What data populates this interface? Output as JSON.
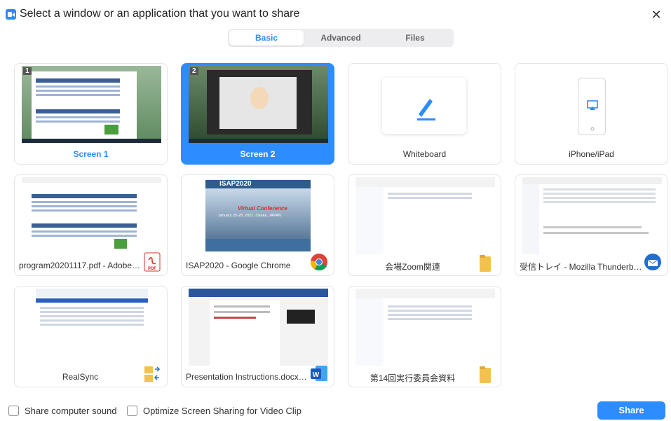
{
  "dialog": {
    "title": "Select a window or an application that you want to share",
    "close_glyph": "✕"
  },
  "tabs": [
    {
      "label": "Basic",
      "active": true
    },
    {
      "label": "Advanced",
      "active": false
    },
    {
      "label": "Files",
      "active": false
    }
  ],
  "items": [
    {
      "label": "Screen 1",
      "number": "1",
      "kind": "screen"
    },
    {
      "label": "Screen 2",
      "number": "2",
      "kind": "screen",
      "selected": true
    },
    {
      "label": "Whiteboard",
      "kind": "whiteboard",
      "icon": "pen-icon"
    },
    {
      "label": "iPhone/iPad",
      "kind": "device",
      "icon": "airplay-icon"
    },
    {
      "label": "program20201117.pdf - Adobe A...",
      "kind": "app",
      "icon": "pdf-icon"
    },
    {
      "label": "ISAP2020 - Google Chrome",
      "kind": "app",
      "icon": "chrome-icon",
      "thumb_title": "ISAP2020",
      "thumb_subtitle": "Virtual Conference",
      "thumb_dates": "January 25-28, 2021, Osaka, JAPAN"
    },
    {
      "label": "会場Zoom関連",
      "kind": "folder",
      "icon": "folder-icon"
    },
    {
      "label": "受信トレイ - Mozilla Thunderbird",
      "kind": "app",
      "icon": "thunderbird-icon"
    },
    {
      "label": "RealSync",
      "kind": "app",
      "icon": "realsync-icon"
    },
    {
      "label": "Presentation Instructions.docx [...",
      "kind": "app",
      "icon": "word-icon"
    },
    {
      "label": "第14回実行委員会資料",
      "kind": "folder",
      "icon": "folder-icon"
    }
  ],
  "footer": {
    "share_sound_label": "Share computer sound",
    "optimize_label": "Optimize Screen Sharing for Video Clip",
    "share_button": "Share"
  },
  "colors": {
    "accent": "#2d8cff"
  }
}
